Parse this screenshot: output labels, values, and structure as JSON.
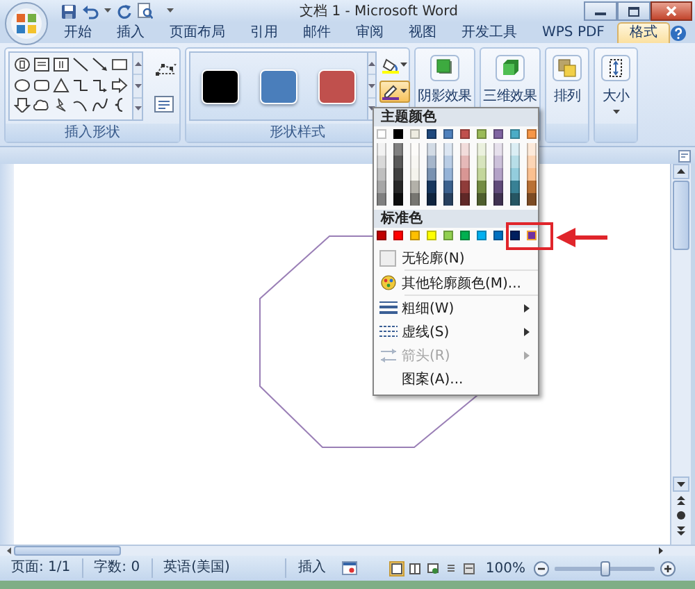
{
  "title_bar": {
    "title": "文档 1 - Microsoft Word"
  },
  "tabs": [
    {
      "label": "开始",
      "selected": false
    },
    {
      "label": "插入",
      "selected": false
    },
    {
      "label": "页面布局",
      "selected": false
    },
    {
      "label": "引用",
      "selected": false
    },
    {
      "label": "邮件",
      "selected": false
    },
    {
      "label": "审阅",
      "selected": false
    },
    {
      "label": "视图",
      "selected": false
    },
    {
      "label": "开发工具",
      "selected": false
    },
    {
      "label": "WPS PDF",
      "selected": false
    },
    {
      "label": "格式",
      "selected": true
    }
  ],
  "ribbon": {
    "insert_shapes": {
      "label": "插入形状"
    },
    "shape_styles": {
      "label": "形状样式",
      "swatches": [
        {
          "color": "#000000"
        },
        {
          "color": "#4a7ebb"
        },
        {
          "color": "#c0504d"
        }
      ]
    },
    "shape_outline": {
      "expanded": true
    },
    "buttons": [
      {
        "label": "阴影效果",
        "kind": "shadow"
      },
      {
        "label": "三维效果",
        "kind": "threed"
      },
      {
        "label": "排列",
        "kind": "arrange"
      },
      {
        "label": "大小",
        "kind": "size"
      }
    ]
  },
  "outline_menu": {
    "theme_header": "主题颜色",
    "theme_colors": [
      {
        "color": "#ffffff"
      },
      {
        "color": "#000000"
      },
      {
        "color": "#eeece1"
      },
      {
        "color": "#1f497d"
      },
      {
        "color": "#4f81bd"
      },
      {
        "color": "#c0504d"
      },
      {
        "color": "#9bbb59"
      },
      {
        "color": "#8064a2"
      },
      {
        "color": "#4bacc6"
      },
      {
        "color": "#f79646"
      }
    ],
    "standard_header": "标准色",
    "standard_colors": [
      {
        "color": "#c00000",
        "selected": false
      },
      {
        "color": "#ff0000",
        "selected": false
      },
      {
        "color": "#ffc000",
        "selected": false
      },
      {
        "color": "#ffff00",
        "selected": false
      },
      {
        "color": "#92d050",
        "selected": false
      },
      {
        "color": "#00b050",
        "selected": false
      },
      {
        "color": "#00b0f0",
        "selected": false
      },
      {
        "color": "#0070c0",
        "selected": false
      },
      {
        "color": "#002060",
        "selected": false
      },
      {
        "color": "#7030a0",
        "selected": true
      }
    ],
    "items": [
      {
        "label": "无轮廓(N)",
        "kind": "none",
        "submenu": false,
        "disabled": false
      },
      {
        "label": "其他轮廓颜色(M)...",
        "kind": "more",
        "submenu": false,
        "disabled": false
      },
      {
        "label": "粗细(W)",
        "kind": "weight",
        "submenu": true,
        "disabled": false
      },
      {
        "label": "虚线(S)",
        "kind": "dash",
        "submenu": true,
        "disabled": false
      },
      {
        "label": "箭头(R)",
        "kind": "arrow",
        "submenu": true,
        "disabled": true
      },
      {
        "label": "图案(A)...",
        "kind": "pattern",
        "submenu": false,
        "disabled": false
      }
    ]
  },
  "annotation": {
    "kind": "callout"
  },
  "status_bar": {
    "page": "页面: 1/1",
    "words": "字数: 0",
    "language": "英语(美国)",
    "mode": "插入",
    "zoom": "100%",
    "zoom_slider": {
      "level": 0.5
    }
  }
}
